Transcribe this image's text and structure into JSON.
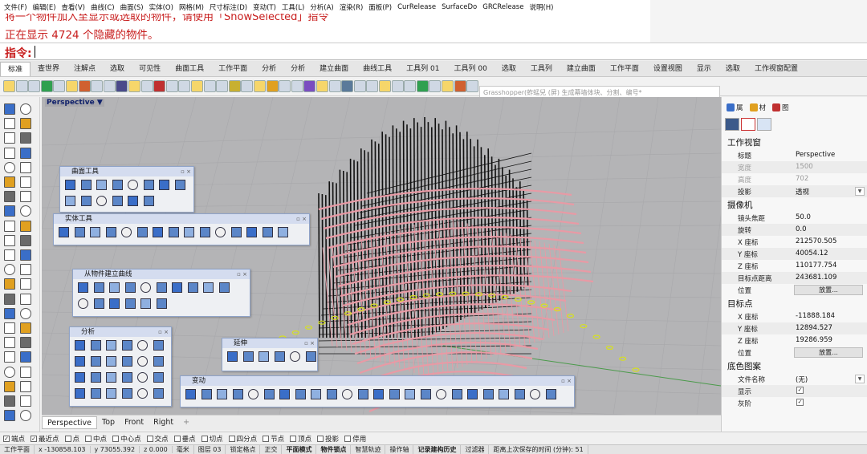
{
  "menu": [
    "文件(F)",
    "编辑(E)",
    "查看(V)",
    "曲线(C)",
    "曲面(S)",
    "实体(O)",
    "网格(M)",
    "尺寸标注(D)",
    "变动(T)",
    "工具(L)",
    "分析(A)",
    "渲染(R)",
    "面板(P)",
    "CurRelease",
    "SurfaceDo",
    "GRCRelease",
    "说明(H)"
  ],
  "history": {
    "line1": "将一个物件加入至显示或选取的物件，请使用「ShowSelected」指令",
    "line2": "正在显示 4724 个隐藏的物件。"
  },
  "command": {
    "label": "指令:",
    "value": ""
  },
  "tabs": [
    "标准",
    "查世界",
    "注解点",
    "选取",
    "可见性",
    "曲面工具",
    "工作平面",
    "分析",
    "分析",
    "建立曲面",
    "曲线工具",
    "工具列 01",
    "工具列 00",
    "选取",
    "工具列",
    "建立曲面",
    "工作平面",
    "设置视图",
    "显示",
    "选取",
    "工作视窗配置"
  ],
  "grasshopper_search": "Grasshopper(蚱蜢兒 (屏) 生成幕墙体块、分割、编号*",
  "viewport": {
    "label": "Perspective",
    "label_arrow": "▼"
  },
  "panels": {
    "curve_tools": "曲面工具",
    "solid_tools": "实体工具",
    "curve_from_objects": "从物件建立曲线",
    "analysis": "分析",
    "extend": "延伸",
    "transform": "变动"
  },
  "view_tabs": [
    "Perspective",
    "Top",
    "Front",
    "Right"
  ],
  "view_tabs_add": "+",
  "osnap": [
    {
      "label": "端点",
      "checked": true
    },
    {
      "label": "最近点",
      "checked": true
    },
    {
      "label": "点",
      "checked": false
    },
    {
      "label": "中点",
      "checked": false
    },
    {
      "label": "中心点",
      "checked": false
    },
    {
      "label": "交点",
      "checked": false
    },
    {
      "label": "垂点",
      "checked": false
    },
    {
      "label": "切点",
      "checked": false
    },
    {
      "label": "四分点",
      "checked": false
    },
    {
      "label": "节点",
      "checked": false
    },
    {
      "label": "顶点",
      "checked": false
    },
    {
      "label": "投影",
      "checked": false
    },
    {
      "label": "停用",
      "checked": false
    }
  ],
  "statusbar": {
    "plane": "工作平面",
    "x": "x -130858.103",
    "y": "y 73055.392",
    "z": "z 0.000",
    "unit": "毫米",
    "layer": "图层 03",
    "items": [
      "锁定格点",
      "正交",
      "平面模式",
      "物件锁点",
      "智慧轨迹",
      "操作轴",
      "记录建构历史",
      "过滤器"
    ],
    "bold_items": [
      "平面模式",
      "物件锁点",
      "记录建构历史"
    ],
    "save_info": "距离上次保存的时间 (分钟): 51"
  },
  "right_panel": {
    "tabs": [
      "属",
      "材",
      "图"
    ],
    "viewport_section": "工作视窗",
    "viewport_props": [
      {
        "k": "标题",
        "v": "Perspective",
        "disabled": false
      },
      {
        "k": "宽度",
        "v": "1500",
        "disabled": true
      },
      {
        "k": "高度",
        "v": "702",
        "disabled": true
      },
      {
        "k": "投影",
        "v": "透视",
        "disabled": false,
        "dropdown": true
      }
    ],
    "camera_section": "摄像机",
    "camera_props": [
      {
        "k": "镜头焦距",
        "v": "50.0"
      },
      {
        "k": "旋转",
        "v": "0.0"
      },
      {
        "k": "X 座标",
        "v": "212570.505"
      },
      {
        "k": "Y 座标",
        "v": "40054.12"
      },
      {
        "k": "Z 座标",
        "v": "110177.754"
      },
      {
        "k": "目标点距离",
        "v": "243681.109"
      }
    ],
    "camera_position_label": "位置",
    "place_button": "放置...",
    "target_section": "目标点",
    "target_props": [
      {
        "k": "X 座标",
        "v": "-11888.184"
      },
      {
        "k": "Y 座标",
        "v": "12894.527"
      },
      {
        "k": "Z 座标",
        "v": "19286.959"
      }
    ],
    "target_position_label": "位置",
    "background_section": "底色图案",
    "file_name_label": "文件名称",
    "file_name_value": "(无)",
    "show_label": "显示",
    "gray_label": "灰阶",
    "show_checked": true,
    "gray_checked": true,
    "check_mark": "✓",
    "more": "···"
  },
  "colors": {
    "history_red": "#c81e1e",
    "mesh_pink": "#e89aa5",
    "mesh_black": "#111111",
    "marker_yellow": "#d6e020",
    "viewport_gray": "#b4b4b6"
  }
}
